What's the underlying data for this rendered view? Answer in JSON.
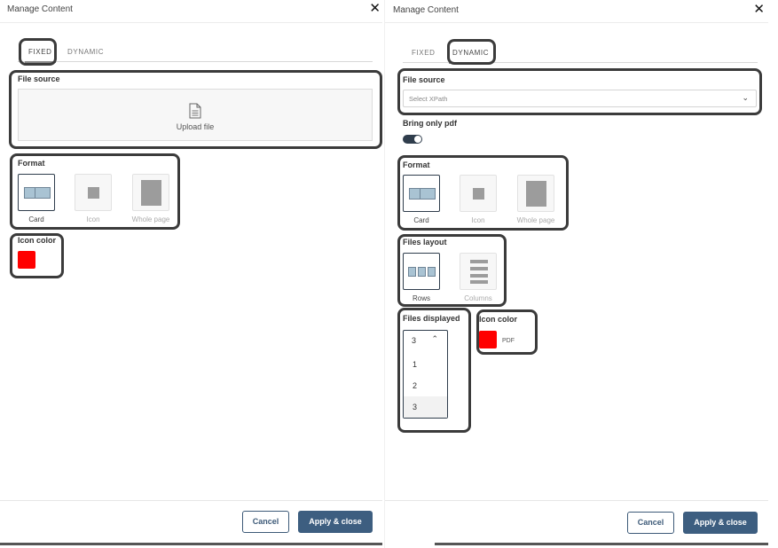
{
  "left_panel": {
    "title": "Manage Content",
    "close_glyph": "✕",
    "tabs": [
      {
        "label": "FIXED",
        "active": true
      },
      {
        "label": "DYNAMIC",
        "active": false
      }
    ],
    "file_source": {
      "label": "File source",
      "upload_label": "Upload file",
      "upload_icon": "document-icon"
    },
    "format": {
      "label": "Format",
      "options": [
        {
          "label": "Card",
          "selected": true
        },
        {
          "label": "Icon",
          "selected": false
        },
        {
          "label": "Whole page",
          "selected": false
        }
      ]
    },
    "icon_color": {
      "label": "Icon color",
      "color": "#ff0000"
    },
    "buttons": {
      "cancel": "Cancel",
      "apply": "Apply & close"
    }
  },
  "right_panel": {
    "title": "Manage Content",
    "close_glyph": "✕",
    "tabs": [
      {
        "label": "FIXED",
        "active": false
      },
      {
        "label": "DYNAMIC",
        "active": true
      }
    ],
    "file_source": {
      "label": "File source",
      "placeholder": "Select XPath",
      "chevron_icon": "chevron-down-icon"
    },
    "bring_only_pdf": {
      "label": "Bring only pdf",
      "enabled": true
    },
    "format": {
      "label": "Format",
      "options": [
        {
          "label": "Card",
          "selected": true
        },
        {
          "label": "Icon",
          "selected": false
        },
        {
          "label": "Whole page",
          "selected": false
        }
      ]
    },
    "files_layout": {
      "label": "Files layout",
      "options": [
        {
          "label": "Rows",
          "selected": true
        },
        {
          "label": "Columns",
          "selected": false
        }
      ]
    },
    "files_displayed": {
      "label": "Files displayed",
      "current": "3",
      "options": [
        "1",
        "2",
        "3"
      ]
    },
    "icon_color": {
      "label": "Icon color",
      "color": "#ff0000",
      "caption": "PDF"
    },
    "buttons": {
      "cancel": "Cancel",
      "apply": "Apply & close"
    }
  },
  "colors": {
    "accent": "#3d5e80",
    "highlight_border": "#3b3b3b",
    "swatch": "#ff0000"
  }
}
